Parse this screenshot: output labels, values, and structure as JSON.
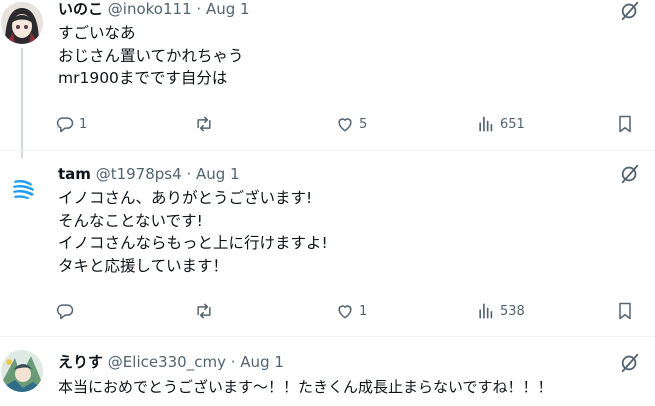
{
  "tweets": [
    {
      "name": "いのこ",
      "handle": "@inoko111",
      "dot": "·",
      "time": "Aug 1",
      "lines": [
        "すごいなあ",
        "おじさん置いてかれちゃう",
        "mr1900までです自分は"
      ],
      "replies": "1",
      "reposts": "",
      "likes": "5",
      "views": "651"
    },
    {
      "name": "tam",
      "handle": "@t1978ps4",
      "dot": "·",
      "time": "Aug 1",
      "lines": [
        "イノコさん、ありがとうございます!",
        "そんなことないです!",
        "イノコさんならもっと上に行けますよ!",
        "タキと応援しています！"
      ],
      "replies": "",
      "reposts": "",
      "likes": "1",
      "views": "538"
    },
    {
      "name": "えりす",
      "handle": "@Elice330_cmy",
      "dot": "·",
      "time": "Aug 1",
      "lines": [
        "本当におめでとうございます〜！！たきくん成長止まらないですね！！！"
      ],
      "replies": "",
      "reposts": "",
      "likes": "",
      "views": ""
    }
  ],
  "colors": {
    "text": "#0f1419",
    "secondary": "#536471",
    "divider": "#eff3f4",
    "thread_line": "#cfd9de",
    "tam_avatar_blue": "#1d9bf0"
  }
}
